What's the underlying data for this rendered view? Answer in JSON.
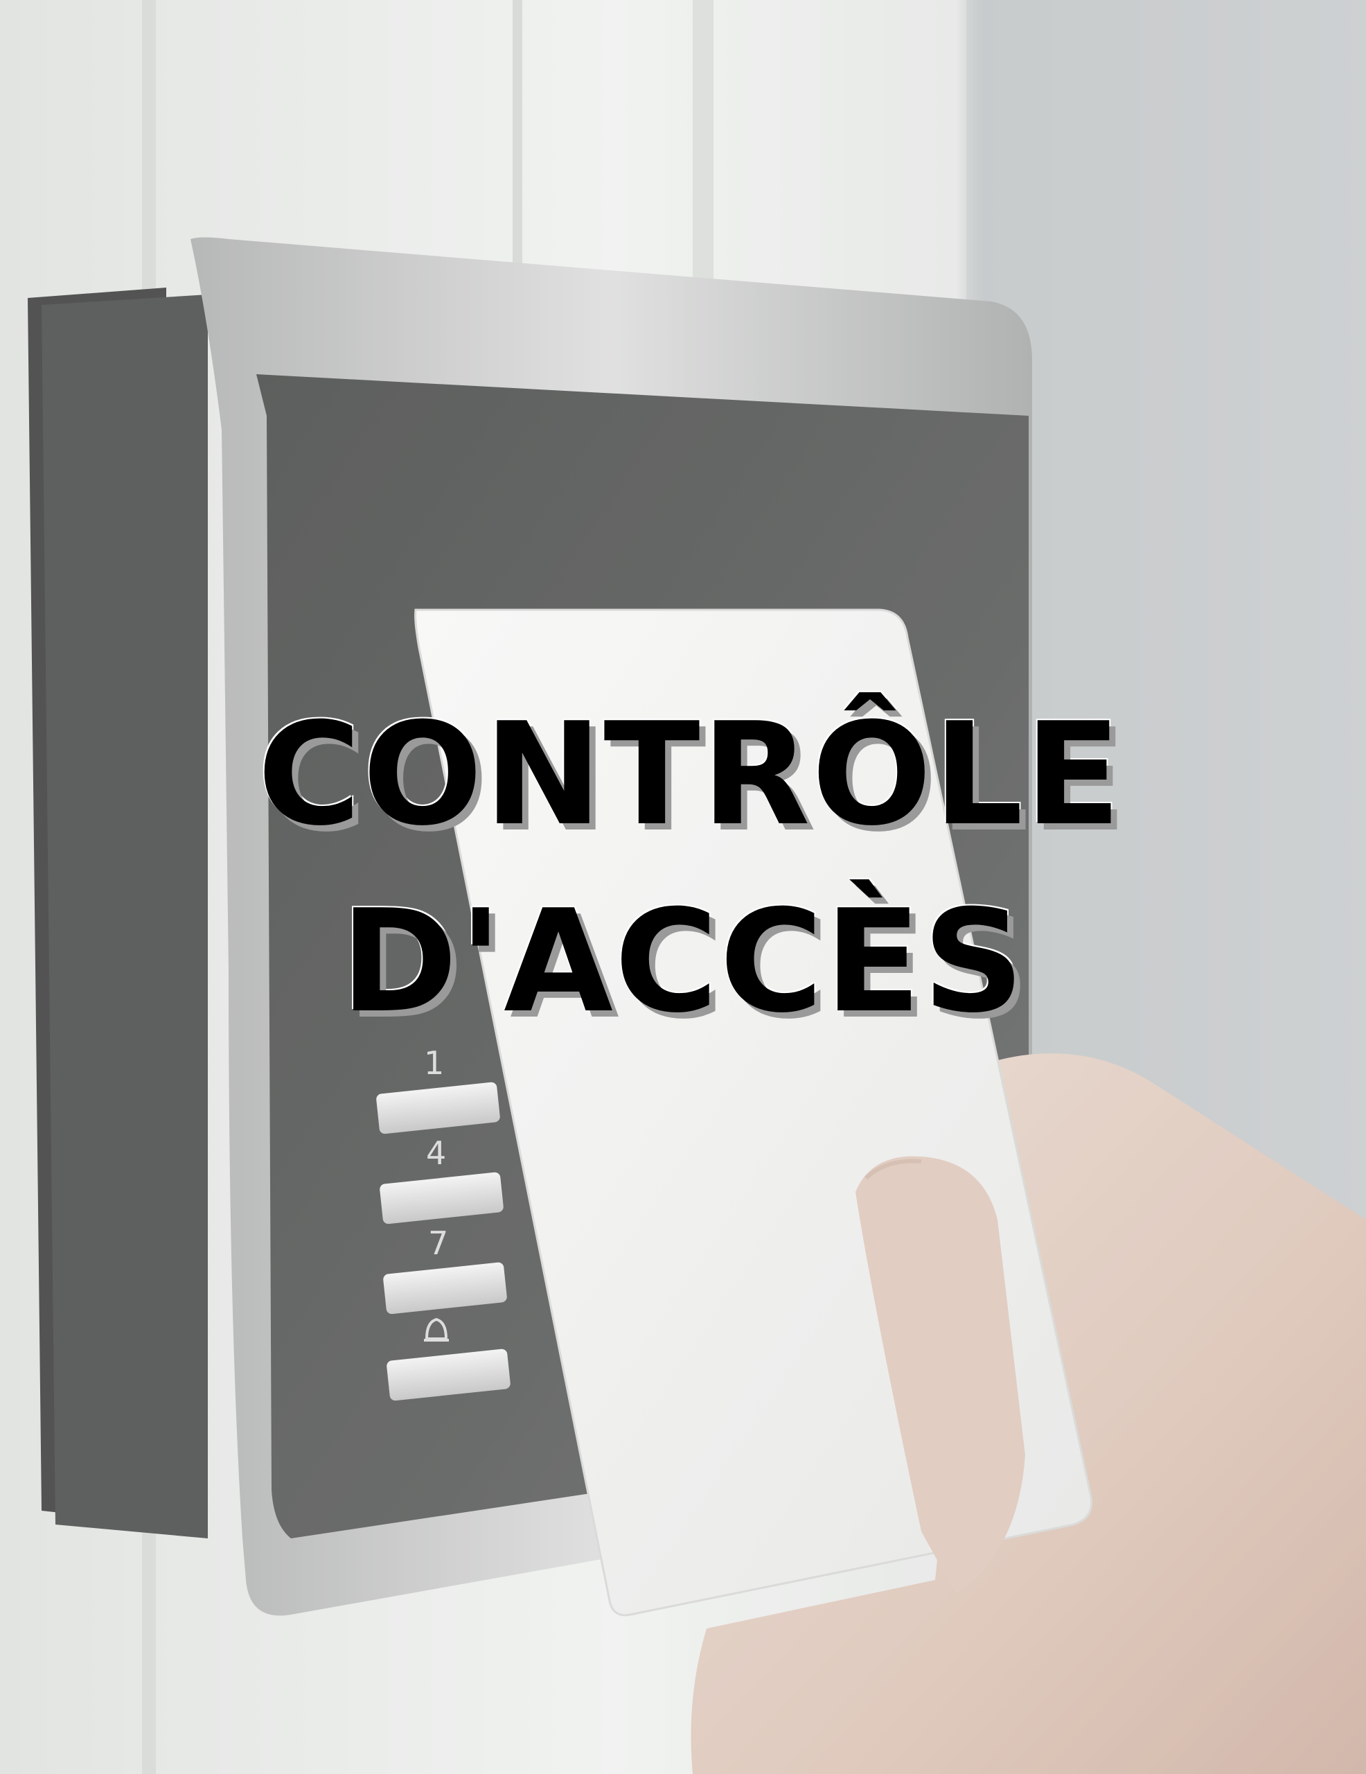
{
  "title": {
    "line1": "CONTRÔLE",
    "line2": "D'ACCÈS"
  },
  "reader": {
    "key_labels": [
      "1",
      "4",
      "7"
    ],
    "bell_key_icon": "bell-icon"
  },
  "colors": {
    "title_text": "#000000",
    "title_shadow": "#9a9a9a",
    "reader_panel": "#3c3e3d",
    "card": "#f3f3f1",
    "wall": "#e6e8e6"
  }
}
